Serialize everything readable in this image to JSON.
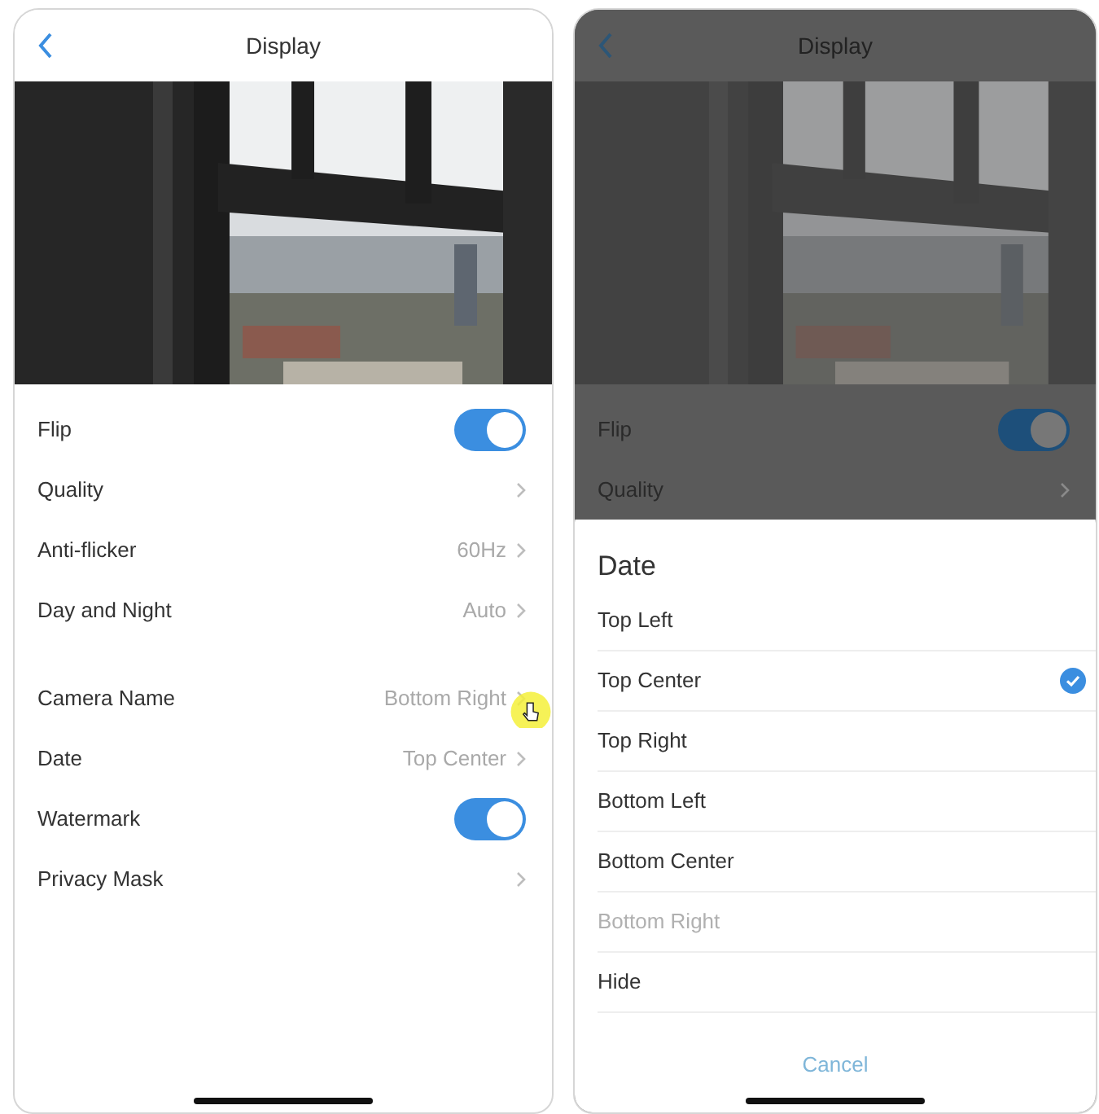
{
  "screens": [
    {
      "header": {
        "title": "Display"
      },
      "preview": {
        "kind": "picture"
      },
      "dimmed": false,
      "groups": [
        [
          {
            "kind": "toggle",
            "label": "Flip",
            "on": true
          },
          {
            "kind": "link",
            "label": "Quality"
          },
          {
            "kind": "link",
            "label": "Anti-flicker",
            "value": "60Hz"
          },
          {
            "kind": "link",
            "label": "Day and Night",
            "value": "Auto"
          }
        ],
        [
          {
            "kind": "link",
            "label": "Camera Name",
            "value": "Bottom Right"
          },
          {
            "kind": "link",
            "label": "Date",
            "value": "Top Center"
          },
          {
            "kind": "toggle",
            "label": "Watermark",
            "on": true
          },
          {
            "kind": "link",
            "label": "Privacy Mask"
          }
        ]
      ]
    },
    {
      "header": {
        "title": "Display"
      },
      "preview": {
        "kind": "picture"
      },
      "dimmed": true,
      "groups": [
        [
          {
            "kind": "toggle",
            "label": "Flip",
            "on": true
          },
          {
            "kind": "link",
            "label": "Quality"
          }
        ]
      ],
      "sheet": {
        "title": "Date",
        "options": [
          {
            "label": "Top Left",
            "selected": false,
            "disabled": false
          },
          {
            "label": "Top Center",
            "selected": true,
            "disabled": false
          },
          {
            "label": "Top Right",
            "selected": false,
            "disabled": false
          },
          {
            "label": "Bottom Left",
            "selected": false,
            "disabled": false
          },
          {
            "label": "Bottom Center",
            "selected": false,
            "disabled": false
          },
          {
            "label": "Bottom Right",
            "selected": false,
            "disabled": true
          },
          {
            "label": "Hide",
            "selected": false,
            "disabled": false
          }
        ],
        "cancel": "Cancel"
      }
    }
  ]
}
